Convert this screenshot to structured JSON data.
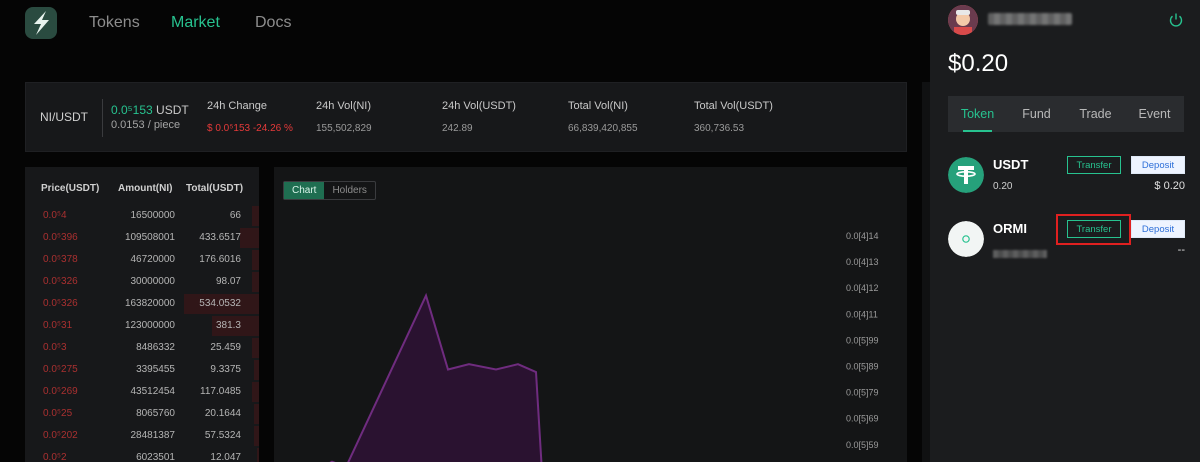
{
  "nav": {
    "logo_icon": "bolt-s-icon",
    "items": [
      {
        "label": "Tokens",
        "active": false
      },
      {
        "label": "Market",
        "active": true
      },
      {
        "label": "Docs",
        "active": false
      }
    ]
  },
  "ticker": {
    "pair": "NI/USDT",
    "price_green": "0.0⁵153",
    "price_unit": " USDT",
    "price_per_piece": "0.0153 / piece",
    "stats": [
      {
        "label": "24h Change",
        "value": "$ 0.0⁵153  -24.26 %",
        "color": "#e53a3a"
      },
      {
        "label": "24h Vol(NI)",
        "value": "155,502,829"
      },
      {
        "label": "24h Vol(USDT)",
        "value": "242.89"
      },
      {
        "label": "Total Vol(NI)",
        "value": "66,839,420,855"
      },
      {
        "label": "Total Vol(USDT)",
        "value": "360,736.53"
      }
    ]
  },
  "orderbook": {
    "headers": [
      "Price(USDT)",
      "Amount(NI)",
      "Total(USDT)"
    ],
    "rows": [
      {
        "price": "0.0⁵4",
        "amount": "16500000",
        "total": "66",
        "depth": 0.03
      },
      {
        "price": "0.0⁵396",
        "amount": "109508001",
        "total": "433.6517",
        "depth": 0.08
      },
      {
        "price": "0.0⁵378",
        "amount": "46720000",
        "total": "176.6016",
        "depth": 0.03
      },
      {
        "price": "0.0⁵326",
        "amount": "30000000",
        "total": "98.07",
        "depth": 0.03
      },
      {
        "price": "0.0⁵326",
        "amount": "163820000",
        "total": "534.0532",
        "depth": 0.32
      },
      {
        "price": "0.0⁵31",
        "amount": "123000000",
        "total": "381.3",
        "depth": 0.2
      },
      {
        "price": "0.0⁵3",
        "amount": "8486332",
        "total": "25.459",
        "depth": 0.03
      },
      {
        "price": "0.0⁵275",
        "amount": "3395455",
        "total": "9.3375",
        "depth": 0.02
      },
      {
        "price": "0.0⁵269",
        "amount": "43512454",
        "total": "117.0485",
        "depth": 0.03
      },
      {
        "price": "0.0⁵25",
        "amount": "8065760",
        "total": "20.1644",
        "depth": 0.02
      },
      {
        "price": "0.0⁵202",
        "amount": "28481387",
        "total": "57.5324",
        "depth": 0.02
      },
      {
        "price": "0.0⁵2",
        "amount": "6023501",
        "total": "12.047",
        "depth": 0.01
      }
    ]
  },
  "chart": {
    "tabs": [
      {
        "label": "Chart",
        "active": true
      },
      {
        "label": "Holders",
        "active": false
      }
    ]
  },
  "chart_data": {
    "type": "area",
    "title": "",
    "xlabel": "",
    "ylabel": "",
    "y_tick_labels": [
      "0.0[4]14",
      "0.0[4]13",
      "0.0[4]12",
      "0.0[4]11",
      "0.0[5]99",
      "0.0[5]89",
      "0.0[5]79",
      "0.0[5]69",
      "0.0[5]59"
    ],
    "ylim": [
      5.7e-06,
      1.45e-05
    ],
    "series": [
      {
        "values": [
          5.5e-06,
          5.9e-06,
          5.7e-06,
          1.22e-05,
          9.4e-06,
          9.6e-06,
          9.4e-06,
          9.6e-06,
          9.3e-06,
          5.5e-06
        ]
      }
    ],
    "color": "#6f2c7f"
  },
  "wallet": {
    "avatar_icon": "avatar-icon",
    "power_icon": "power-icon",
    "balance": "$0.20",
    "tabs": [
      {
        "label": "Token",
        "active": true
      },
      {
        "label": "Fund",
        "active": false
      },
      {
        "label": "Trade",
        "active": false
      },
      {
        "label": "Event",
        "active": false
      }
    ],
    "tokens": [
      {
        "name": "USDT",
        "balance": "0.20",
        "value": "$ 0.20",
        "transfer_label": "Transfer",
        "deposit_label": "Deposit",
        "icon": "tether-icon",
        "icon_color": "#26a17b"
      },
      {
        "name": "ORMI",
        "balance": "",
        "value": "--",
        "transfer_label": "Transfer",
        "deposit_label": "Deposit",
        "icon": "ormi-icon",
        "icon_color": "#f2f5f4"
      }
    ]
  }
}
